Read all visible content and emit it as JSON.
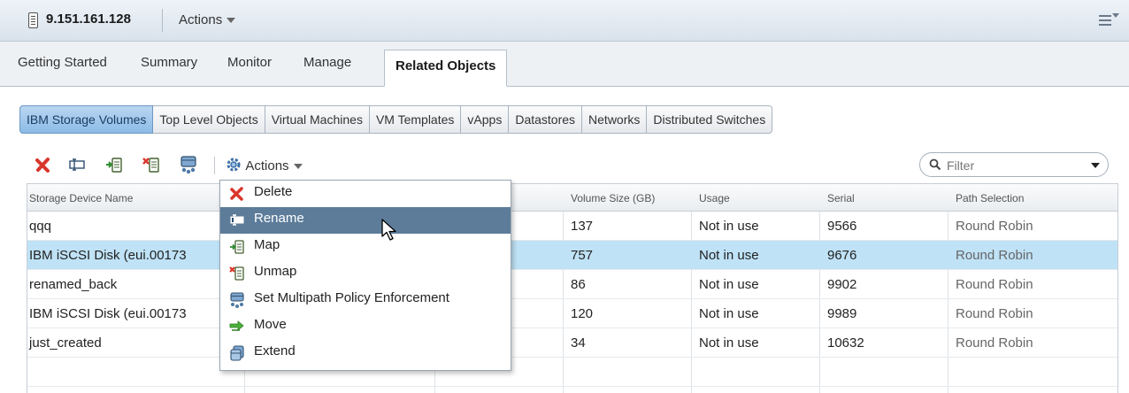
{
  "window": {
    "title": "9.151.161.128",
    "actions_label": "Actions"
  },
  "tabs": [
    {
      "label": "Getting Started"
    },
    {
      "label": "Summary"
    },
    {
      "label": "Monitor"
    },
    {
      "label": "Manage"
    },
    {
      "label": "Related Objects",
      "active": true
    }
  ],
  "subtabs": [
    {
      "label": "IBM Storage Volumes",
      "active": true
    },
    {
      "label": "Top Level Objects"
    },
    {
      "label": "Virtual Machines"
    },
    {
      "label": "VM Templates"
    },
    {
      "label": "vApps"
    },
    {
      "label": "Datastores"
    },
    {
      "label": "Networks"
    },
    {
      "label": "Distributed Switches"
    }
  ],
  "toolbar": {
    "actions_label": "Actions",
    "icons": [
      "delete-icon",
      "rename-icon",
      "map-icon",
      "unmap-icon",
      "multipath-policy-icon",
      "actions-gear-icon"
    ]
  },
  "filter": {
    "placeholder": "Filter"
  },
  "table": {
    "columns": [
      "Storage Device Name",
      "",
      "",
      "Volume Size (GB)",
      "Usage",
      "Serial",
      "Path Selection"
    ],
    "rows": [
      {
        "name": "qqq",
        "size": "137",
        "usage": "Not in use",
        "serial": "9566",
        "path": "Round Robin"
      },
      {
        "name": "IBM iSCSI Disk (eui.00173",
        "size": "757",
        "usage": "Not in use",
        "serial": "9676",
        "path": "Round Robin",
        "selected": true
      },
      {
        "name": "renamed_back",
        "size": "86",
        "usage": "Not in use",
        "serial": "9902",
        "path": "Round Robin"
      },
      {
        "name": "IBM iSCSI Disk (eui.00173",
        "size": "120",
        "usage": "Not in use",
        "serial": "9989",
        "path": "Round Robin"
      },
      {
        "name": "just_created",
        "size": "34",
        "usage": "Not in use",
        "serial": "10632",
        "path": "Round Robin"
      }
    ]
  },
  "context_menu": {
    "items": [
      {
        "label": "Delete",
        "icon": "delete-icon"
      },
      {
        "label": "Rename",
        "icon": "rename-icon",
        "highlighted": true
      },
      {
        "label": "Map",
        "icon": "map-icon"
      },
      {
        "label": "Unmap",
        "icon": "unmap-icon"
      },
      {
        "label": "Set Multipath Policy Enforcement",
        "icon": "multipath-policy-icon"
      },
      {
        "label": "Move",
        "icon": "move-icon"
      },
      {
        "label": "Extend",
        "icon": "extend-icon"
      }
    ]
  },
  "colors": {
    "active_subtab": "#8dbbe6",
    "selected_row": "#bfe2f6",
    "menu_highlight": "#5d7c9a",
    "delete_red": "#d9362b"
  }
}
